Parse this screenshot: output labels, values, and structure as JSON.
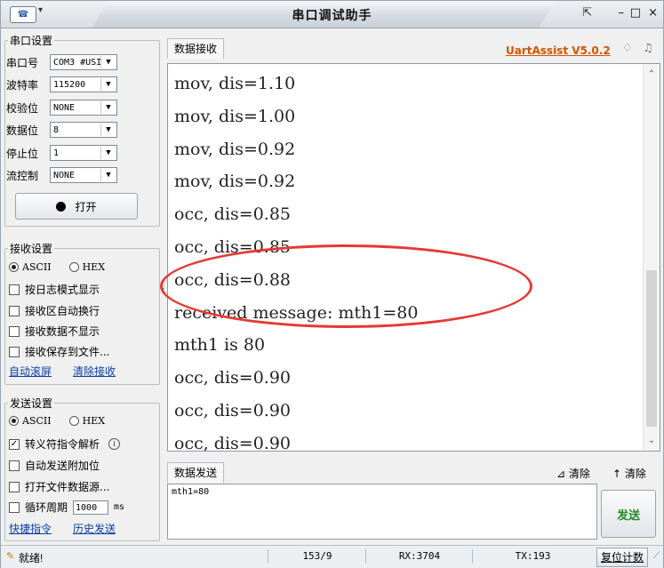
{
  "window": {
    "title": "串口调试助手",
    "app_icon": "modem-icon"
  },
  "serial_settings": {
    "title": "串口设置",
    "fields": [
      {
        "label": "串口号",
        "value": "COM3 #USI"
      },
      {
        "label": "波特率",
        "value": "115200"
      },
      {
        "label": "校验位",
        "value": "NONE"
      },
      {
        "label": "数据位",
        "value": "8"
      },
      {
        "label": "停止位",
        "value": "1"
      },
      {
        "label": "流控制",
        "value": "NONE"
      }
    ],
    "open_button": "打开"
  },
  "receive_settings": {
    "title": "接收设置",
    "mode_ascii": "ASCII",
    "mode_hex": "HEX",
    "selected_mode": "ASCII",
    "options": [
      {
        "label": "按日志模式显示",
        "checked": false
      },
      {
        "label": "接收区自动换行",
        "checked": false
      },
      {
        "label": "接收数据不显示",
        "checked": false
      },
      {
        "label": "接收保存到文件...",
        "checked": false
      }
    ],
    "auto_scroll_link": "自动滚屏",
    "clear_link": "清除接收"
  },
  "send_settings": {
    "title": "发送设置",
    "mode_ascii": "ASCII",
    "mode_hex": "HEX",
    "selected_mode": "ASCII",
    "options": [
      {
        "label": "转义符指令解析",
        "checked": true
      },
      {
        "label": "自动发送附加位",
        "checked": false
      },
      {
        "label": "打开文件数据源...",
        "checked": false
      },
      {
        "label": "循环周期",
        "checked": false
      }
    ],
    "cycle_value": "1000",
    "cycle_unit": "ms",
    "shortcut_link": "快捷指令",
    "history_link": "历史发送"
  },
  "receive": {
    "tab_label": "数据接收",
    "brand": "UartAssist V5.0.2",
    "lines": [
      "mov, dis=1.10",
      "mov, dis=1.00",
      "mov, dis=0.92",
      "mov, dis=0.92",
      "occ, dis=0.85",
      "occ, dis=0.85",
      "occ, dis=0.88",
      "received message: mth1=80",
      "mth1 is 80",
      "occ, dis=0.90",
      "occ, dis=0.90",
      "occ, dis=0.90",
      "occ, dis=0.90"
    ]
  },
  "send": {
    "tab_label": "数据发送",
    "clear_label_1": "清除",
    "clear_label_2": "清除",
    "input_value": "mth1=80",
    "send_button": "发送"
  },
  "status": {
    "ready": "就绪!",
    "counter": "153/9",
    "rx": "RX:3704",
    "tx": "TX:193",
    "reset_button": "复位计数"
  },
  "colors": {
    "brand": "#d35400",
    "send_button_text": "#1f8a2b",
    "highlight_ellipse": "#e53935",
    "link": "#0b3fa6"
  }
}
